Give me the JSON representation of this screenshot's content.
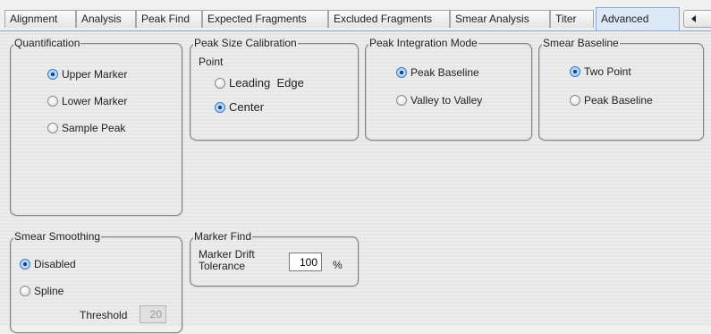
{
  "tabs": [
    {
      "label": "Alignment"
    },
    {
      "label": "Analysis"
    },
    {
      "label": "Peak Find"
    },
    {
      "label": "Expected Fragments"
    },
    {
      "label": "Excluded Fragments"
    },
    {
      "label": "Smear Analysis"
    },
    {
      "label": "Titer"
    },
    {
      "label": "Advanced",
      "active": true
    }
  ],
  "quantification": {
    "title": "Quantification",
    "options": [
      "Upper Marker",
      "Lower Marker",
      "Sample Peak"
    ],
    "selected": "Upper Marker"
  },
  "peak_size_calibration": {
    "title_line1": "Peak Size Calibration",
    "title_line2": "Point",
    "options": [
      "Leading  Edge",
      "Center"
    ],
    "selected": "Center"
  },
  "peak_integration_mode": {
    "title": "Peak Integration Mode",
    "options": [
      "Peak Baseline",
      "Valley to Valley"
    ],
    "selected": "Peak Baseline"
  },
  "smear_baseline": {
    "title": "Smear Baseline",
    "options": [
      "Two Point",
      "Peak Baseline"
    ],
    "selected": "Two Point"
  },
  "smear_smoothing": {
    "title": "Smear Smoothing",
    "options": [
      "Disabled",
      "Spline"
    ],
    "selected": "Disabled",
    "threshold_label": "Threshold",
    "threshold_value": "20"
  },
  "marker_find": {
    "title": "Marker Find",
    "tolerance_label_line1": "Marker Drift",
    "tolerance_label_line2": "Tolerance",
    "tolerance_value": "100",
    "tolerance_unit": "%"
  },
  "tab_scroll_icon": "chevron-left-icon"
}
